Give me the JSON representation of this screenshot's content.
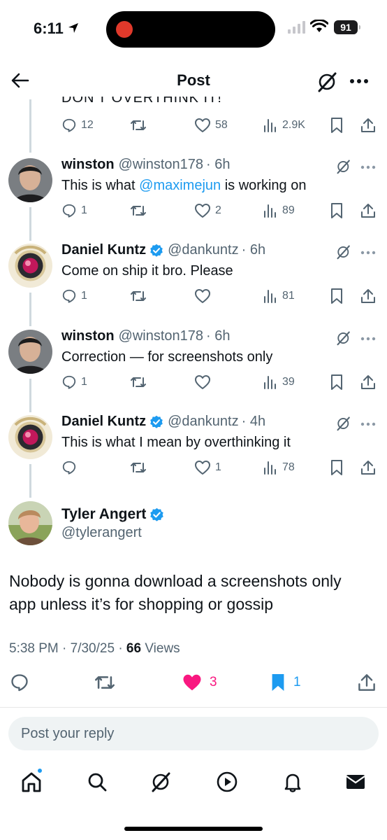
{
  "status_bar": {
    "time": "6:11",
    "battery": "91"
  },
  "header": {
    "title": "Post"
  },
  "cut_text": "DON'T OVERTHINK IT!",
  "top_stats": {
    "replies": "12",
    "likes": "58",
    "views": "2.9K"
  },
  "replies": [
    {
      "name": "winston",
      "handle": "@winston178",
      "time": "· 6h",
      "text_before": "This is what ",
      "mention": "@maximejun",
      "text_after": " is working on",
      "replies": "1",
      "likes": "2",
      "views": "89"
    },
    {
      "name": "Daniel Kuntz",
      "handle": "@dankuntz",
      "time": "· 6h",
      "text": "Come on ship it bro. Please",
      "replies": "1",
      "likes": "",
      "views": "81"
    },
    {
      "name": "winston",
      "handle": "@winston178",
      "time": "· 6h",
      "text": "Correction — for screenshots only",
      "replies": "1",
      "likes": "",
      "views": "39"
    },
    {
      "name": "Daniel Kuntz",
      "handle": "@dankuntz",
      "time": "· 4h",
      "text": "This is what I mean by overthinking it",
      "replies": "",
      "likes": "1",
      "views": "78"
    }
  ],
  "main_post": {
    "name": "Tyler Angert",
    "handle": "@tylerangert",
    "text": "Nobody is gonna download a screenshots only app unless it’s for shopping or gossip",
    "time": "5:38 PM · 7/30/25 · ",
    "views_count": "66",
    "views_label": " Views",
    "likes": "3",
    "bookmarks": "1"
  },
  "reply_box": {
    "placeholder": "Post your reply"
  },
  "colors": {
    "accent": "#1d9bf0",
    "like": "#f91880",
    "muted": "#536471"
  }
}
